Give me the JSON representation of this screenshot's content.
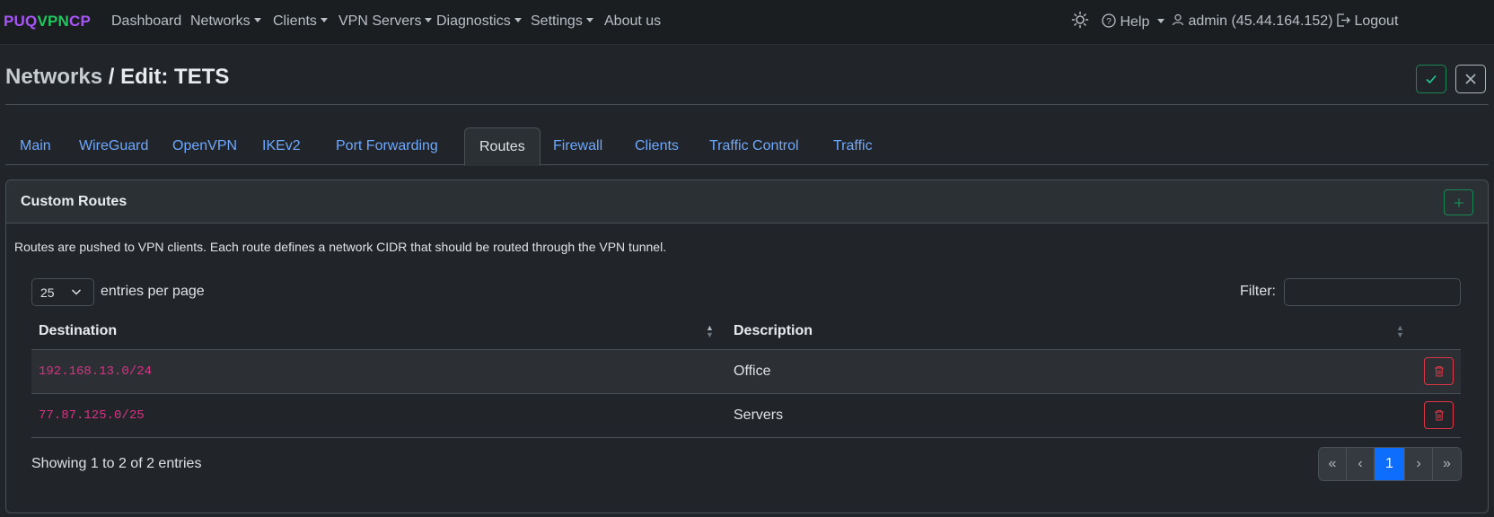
{
  "brand": {
    "part1": "PUQ",
    "part2": "VPN",
    "part3": "CP"
  },
  "nav": {
    "dashboard": "Dashboard",
    "networks": "Networks",
    "clients": "Clients",
    "vpn_servers": "VPN Servers",
    "diagnostics": "Diagnostics",
    "settings": "Settings",
    "about": "About us",
    "help": "Help",
    "user": "admin (45.44.164.152)",
    "logout": "Logout"
  },
  "page": {
    "crumb": "Networks",
    "separator": " / ",
    "title": "Edit: TETS"
  },
  "tabs": [
    "Main",
    "WireGuard",
    "OpenVPN",
    "IKEv2",
    "Port Forwarding",
    "Routes",
    "Firewall",
    "Clients",
    "Traffic Control",
    "Traffic"
  ],
  "active_tab": "Routes",
  "card": {
    "title": "Custom Routes",
    "description": "Routes are pushed to VPN clients. Each route defines a network CIDR that should be routed through the VPN tunnel."
  },
  "table": {
    "page_length": "25",
    "entries_label": "entries per page",
    "filter_label": "Filter:",
    "filter_value": "",
    "columns": [
      "Destination",
      "Description"
    ],
    "rows": [
      {
        "destination": "192.168.13.0/24",
        "description": "Office"
      },
      {
        "destination": "77.87.125.0/25",
        "description": "Servers"
      }
    ],
    "info": "Showing 1 to 2 of 2 entries",
    "pagination": {
      "first": "«",
      "prev": "‹",
      "current": "1",
      "next": "›",
      "last": "»"
    }
  },
  "colors": {
    "primary": "#0d6efd",
    "success": "#198754",
    "danger": "#dc3545",
    "link": "#6ea8fe",
    "code": "#d63384"
  },
  "icons": [
    "theme-sun-icon",
    "help-circle-icon",
    "user-icon",
    "logout-icon",
    "check-icon",
    "close-icon",
    "plus-icon",
    "trash-icon",
    "sort-icon",
    "chevron-down-icon"
  ]
}
